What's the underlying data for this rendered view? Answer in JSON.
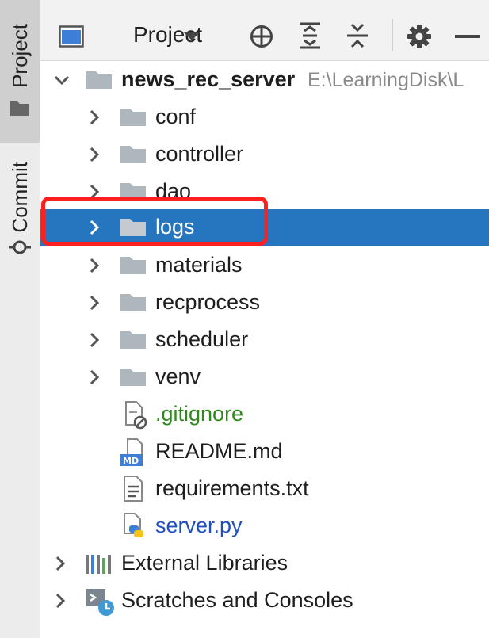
{
  "sidebar": {
    "tabs": [
      {
        "label": "Project",
        "icon": "folder-icon"
      },
      {
        "label": "Commit",
        "icon": "commit-icon"
      }
    ]
  },
  "toolbar": {
    "view_title": "Project",
    "icons": [
      "view-icon",
      "dropdown-icon",
      "locate-icon",
      "expand-all-icon",
      "collapse-all-icon",
      "gear-icon",
      "minimize-icon"
    ]
  },
  "tree": {
    "root": {
      "name": "news_rec_server",
      "path": "E:\\LearningDisk\\L"
    },
    "children": [
      {
        "label": "conf",
        "type": "folder"
      },
      {
        "label": "controller",
        "type": "folder"
      },
      {
        "label": "dao",
        "type": "folder"
      },
      {
        "label": "logs",
        "type": "folder",
        "selected": true
      },
      {
        "label": "materials",
        "type": "folder"
      },
      {
        "label": "recprocess",
        "type": "folder"
      },
      {
        "label": "scheduler",
        "type": "folder"
      },
      {
        "label": "venv",
        "type": "folder"
      },
      {
        "label": ".gitignore",
        "type": "file",
        "icon": "gitignore-file-icon",
        "color": "#2f8a1c"
      },
      {
        "label": "README.md",
        "type": "file",
        "icon": "markdown-file-icon",
        "color": "#1e1e1e"
      },
      {
        "label": "requirements.txt",
        "type": "file",
        "icon": "text-file-icon",
        "color": "#1e1e1e"
      },
      {
        "label": "server.py",
        "type": "file",
        "icon": "python-file-icon",
        "color": "#1f4fbf"
      }
    ],
    "bottom_items": [
      {
        "label": "External Libraries",
        "icon": "libraries-icon"
      },
      {
        "label": "Scratches and Consoles",
        "icon": "scratches-icon"
      }
    ]
  },
  "highlight": {
    "target": "logs",
    "color": "#ff1f1f"
  },
  "colors": {
    "selection": "#2675bf",
    "folder": "#aeb6be"
  }
}
